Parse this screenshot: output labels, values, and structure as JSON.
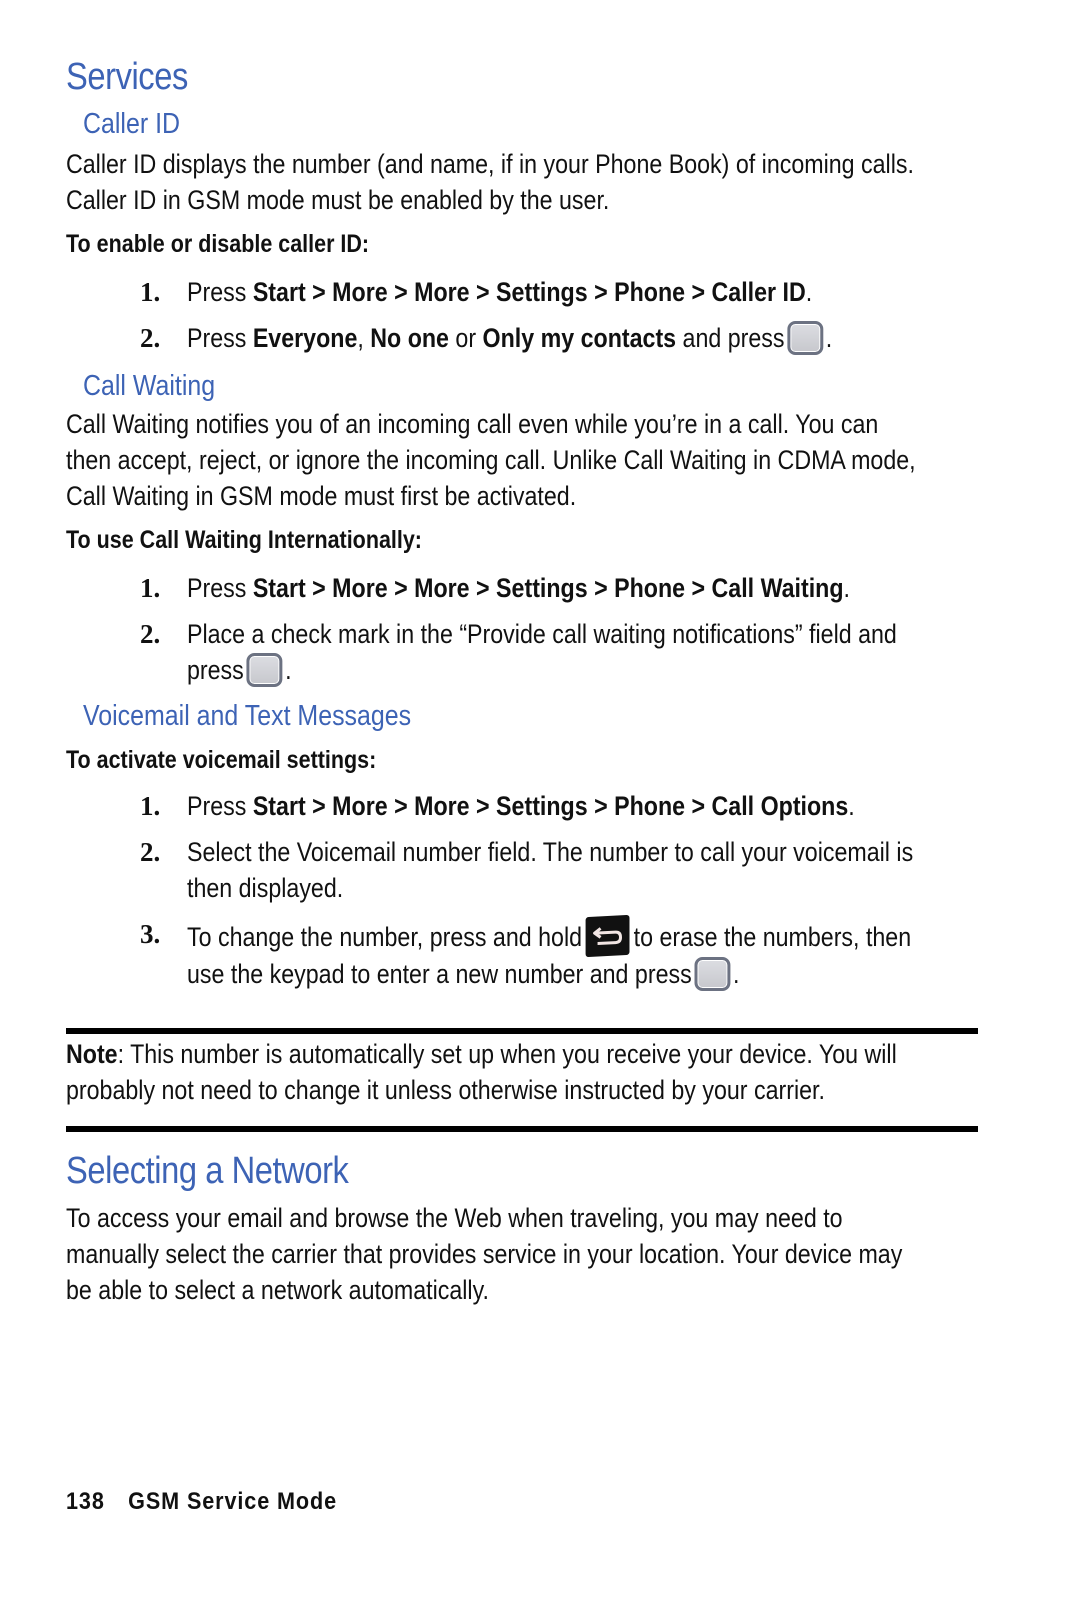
{
  "page": {
    "title": "Services",
    "sections": {
      "caller_id": {
        "heading": "Caller ID",
        "body_lines": [
          "Caller ID displays the number (and name, if in your Phone Book) of incoming calls.",
          "Caller ID in GSM mode must be enabled by the user."
        ],
        "procedure_title": "To enable or disable caller ID:",
        "steps": [
          {
            "num": "1.",
            "prefix": "Press ",
            "path": "Start > More > More > Settings > Phone > Caller ID",
            "suffix": "."
          },
          {
            "num": "2.",
            "prefix": "Press ",
            "opt1": "Everyone",
            "sep1": ", ",
            "opt2": "No one",
            "sep2": " or ",
            "opt3": "Only my contacts",
            "suffix": " and press",
            "end": ".",
            "icon": "ok-key-icon"
          }
        ]
      },
      "call_waiting": {
        "heading": "Call Waiting",
        "body_lines": [
          "Call Waiting notifies you of an incoming call even while you’re in a call. You can",
          "then accept, reject, or ignore the incoming call. Unlike Call Waiting in CDMA mode,",
          "Call Waiting in GSM mode must first be activated."
        ],
        "procedure_title": "To use Call Waiting Internationally:",
        "steps": [
          {
            "num": "1.",
            "prefix": "Press ",
            "path": "Start > More > More > Settings > Phone > Call Waiting",
            "suffix": "."
          },
          {
            "num": "2.",
            "line1": "Place a check mark in the “Provide call waiting notifications” field and",
            "line2": "press",
            "end": ".",
            "icon": "ok-key-icon"
          }
        ]
      },
      "voicemail": {
        "heading": "Voicemail and Text Messages",
        "procedure_title": "To activate voicemail settings:",
        "steps": [
          {
            "num": "1.",
            "prefix": "Press ",
            "path": "Start > More > More > Settings > Phone > Call Options",
            "suffix": "."
          },
          {
            "num": "2.",
            "line1": "Select the Voicemail number field. The number to call your voicemail is",
            "line2": "then displayed."
          },
          {
            "num": "3.",
            "line1a": "To change the number, press and hold",
            "line1b": "to erase the numbers, then",
            "line2": "use the keypad to enter a new number and press",
            "end": ".",
            "icons": [
              "back-key-icon",
              "ok-key-icon"
            ]
          }
        ]
      },
      "note": {
        "label": "Note",
        "line1": ": This number is automatically set up when you receive your device. You will",
        "line2": "probably not need to change it unless otherwise instructed by your carrier."
      },
      "selecting_network": {
        "heading": "Selecting a Network",
        "body_lines": [
          "To access your email and browse the Web when traveling, you may need to",
          "manually select the carrier that provides service in your location. Your device may",
          "be able to select a network automatically."
        ]
      }
    },
    "footer": {
      "page_number": "138",
      "section": "GSM Service Mode"
    }
  }
}
